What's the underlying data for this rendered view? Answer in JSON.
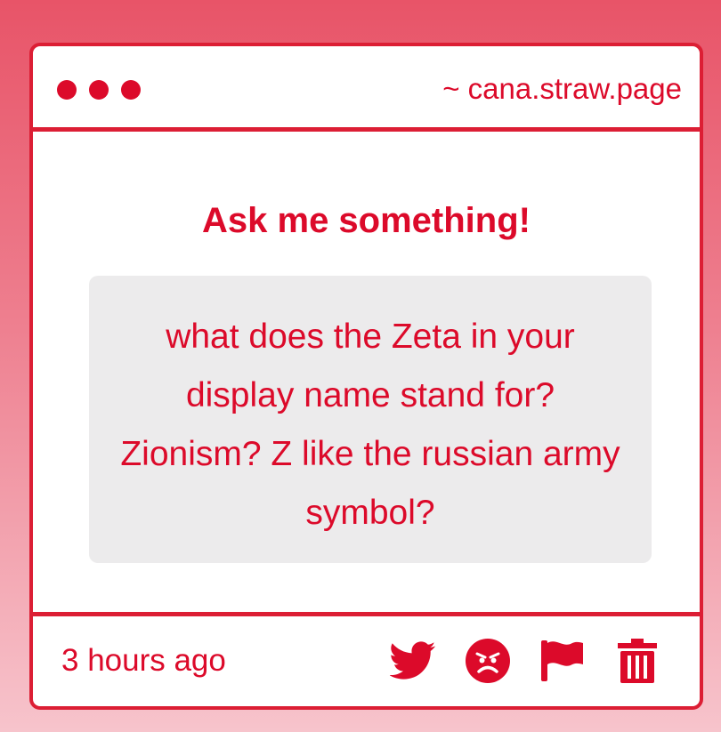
{
  "window": {
    "dots": [
      "red-dot",
      "red-dot",
      "red-dot"
    ],
    "url": "~ cana.straw.page"
  },
  "main": {
    "heading": "Ask me something!",
    "question": "what does the Zeta in your display name stand for? Zionism? Z like the russian army symbol?"
  },
  "footer": {
    "timestamp": "3 hours ago",
    "actions": [
      "twitter-icon",
      "angry-face-icon",
      "flag-icon",
      "trash-icon"
    ]
  },
  "colors": {
    "accent": "#dc0a2a",
    "border": "#dc1e34",
    "question_bg": "#ecebec",
    "background_top": "#e85468",
    "background_bottom": "#f7c4cc"
  }
}
